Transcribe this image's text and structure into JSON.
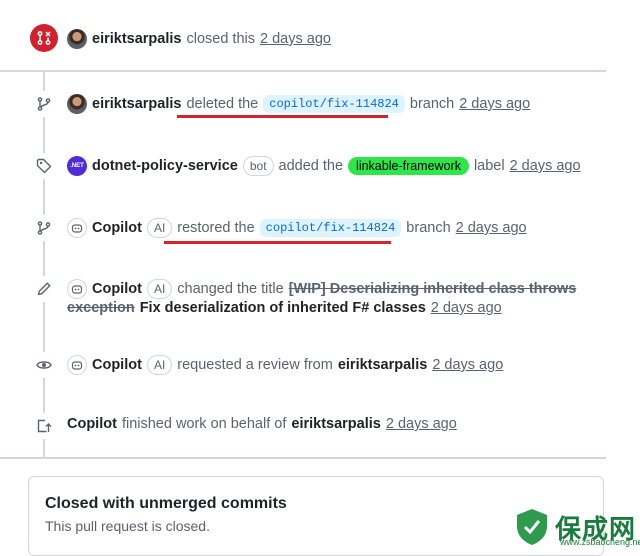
{
  "closed_event": {
    "user": "eiriktsarpalis",
    "action": "closed this",
    "time": "2 days ago"
  },
  "events": [
    {
      "id": "deleted",
      "user": "eiriktsarpalis",
      "pre": "deleted the",
      "branch": "copilot/fix-114824",
      "post": "branch",
      "time": "2 days ago"
    },
    {
      "id": "labeled",
      "user": "dotnet-policy-service",
      "badge": "bot",
      "pre": "added the",
      "label": "linkable-framework",
      "post": "label",
      "time": "2 days ago"
    },
    {
      "id": "restored",
      "user": "Copilot",
      "badge": "AI",
      "pre": "restored the",
      "branch": "copilot/fix-114824",
      "post": "branch",
      "time": "2 days ago"
    },
    {
      "id": "renamed",
      "user": "Copilot",
      "badge": "AI",
      "pre": "changed the title",
      "old_title_a": "[WIP] Deserializing inherited class throws",
      "old_title_b": "exception",
      "new_title": "Fix deserialization of inherited F# classes",
      "time": "2 days ago"
    },
    {
      "id": "review",
      "user": "Copilot",
      "badge": "AI",
      "pre": "requested a review from",
      "reviewer": "eiriktsarpalis",
      "time": "2 days ago"
    },
    {
      "id": "finished",
      "user": "Copilot",
      "pre": "finished work on behalf of",
      "reviewer": "eiriktsarpalis",
      "time": "2 days ago"
    }
  ],
  "status_box": {
    "title": "Closed with unmerged commits",
    "subtitle": "This pull request is closed."
  },
  "watermark": {
    "text": "保成网",
    "url": "www.zsbaocheng.net"
  },
  "colors": {
    "closed": "#cf222e",
    "label": "#2ee64a",
    "branch_bg": "#ddf4ff",
    "annotation": "#d1242f"
  }
}
